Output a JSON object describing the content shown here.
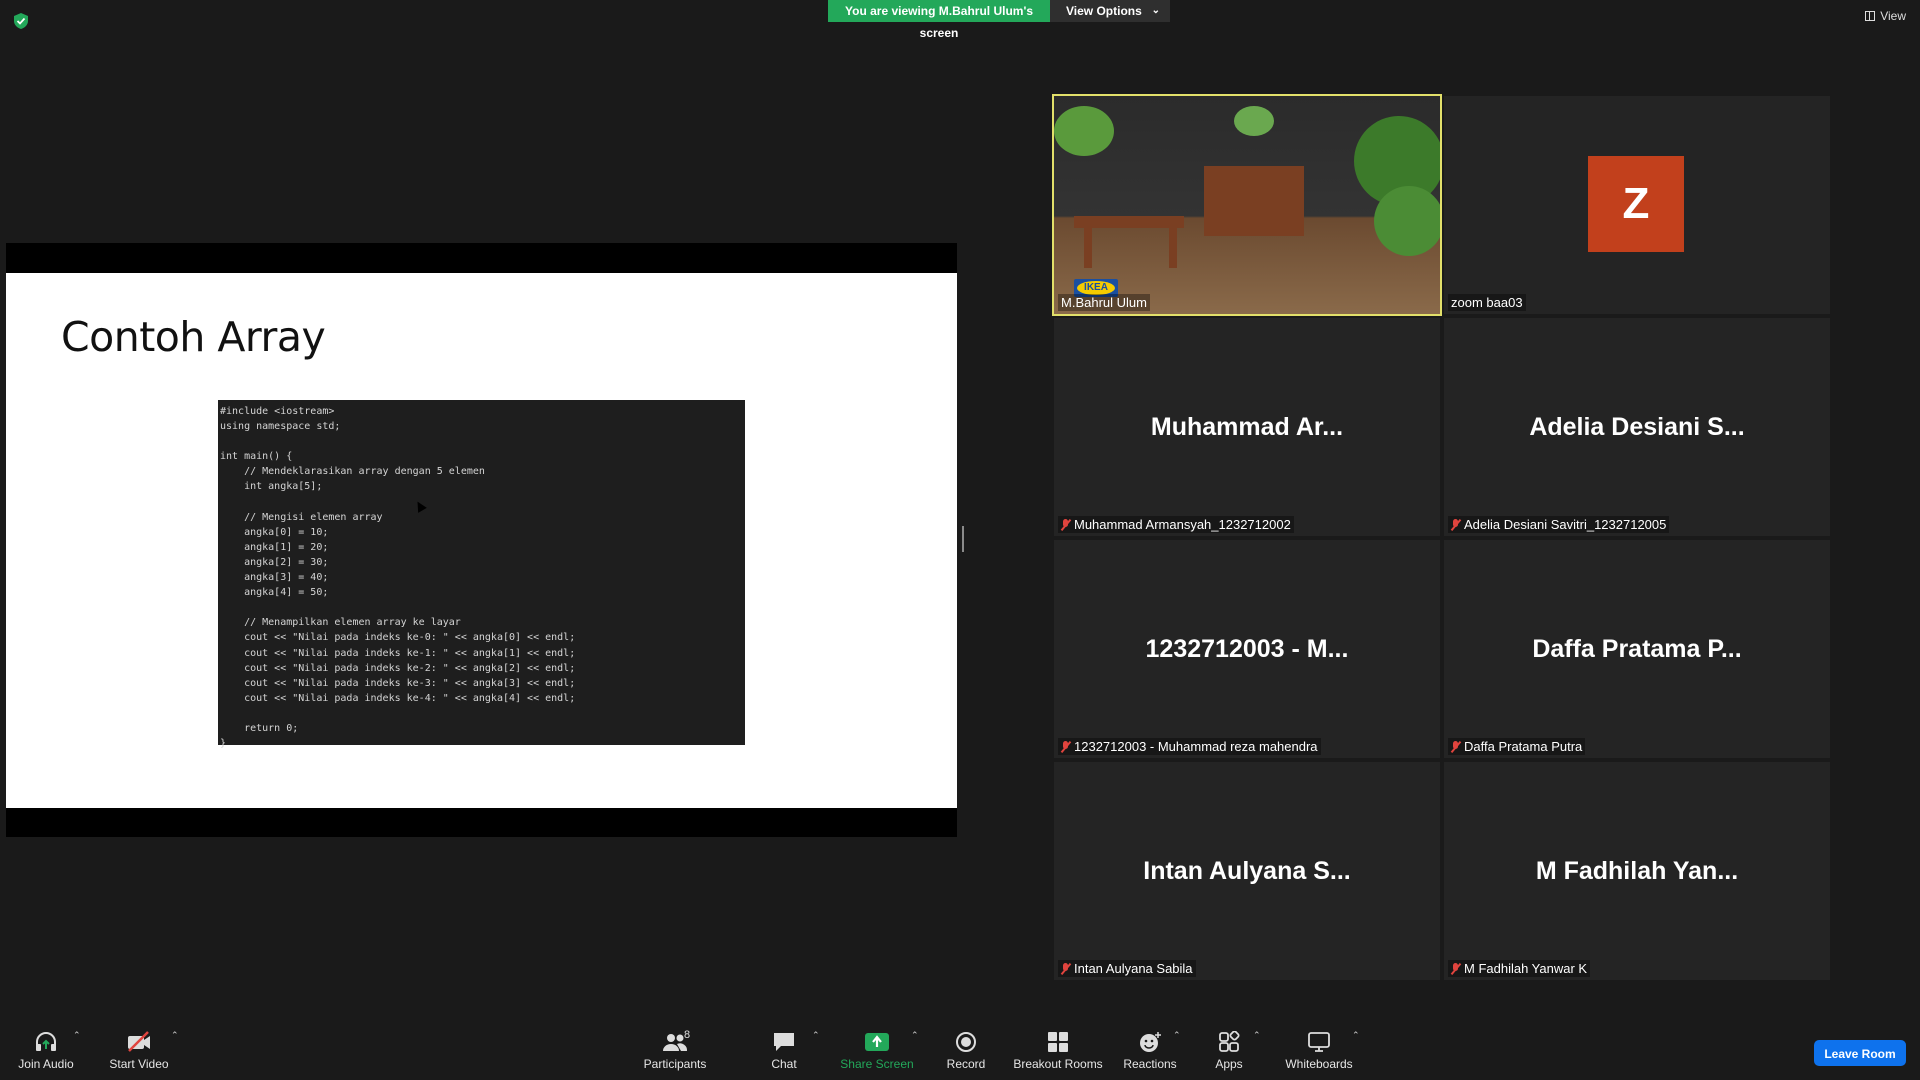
{
  "top": {
    "banner_text": "You are viewing M.Bahrul Ulum's screen",
    "view_options_label": "View Options",
    "view_label": "View",
    "banner_color": "#23a85a"
  },
  "shared_screen": {
    "slide_title": "Contoh Array",
    "code": "#include <iostream>\nusing namespace std;\n\nint main() {\n    // Mendeklarasikan array dengan 5 elemen\n    int angka[5];\n\n    // Mengisi elemen array\n    angka[0] = 10;\n    angka[1] = 20;\n    angka[2] = 30;\n    angka[3] = 40;\n    angka[4] = 50;\n\n    // Menampilkan elemen array ke layar\n    cout << \"Nilai pada indeks ke-0: \" << angka[0] << endl;\n    cout << \"Nilai pada indeks ke-1: \" << angka[1] << endl;\n    cout << \"Nilai pada indeks ke-2: \" << angka[2] << endl;\n    cout << \"Nilai pada indeks ke-3: \" << angka[3] << endl;\n    cout << \"Nilai pada indeks ke-4: \" << angka[4] << endl;\n\n    return 0;\n}"
  },
  "participants_gallery": [
    {
      "display": "",
      "label": "M.Bahrul Ulum",
      "type": "video",
      "active": true,
      "muted": false
    },
    {
      "display": "Z",
      "label": "zoom baa03",
      "type": "avatar",
      "muted": false,
      "avatar_color": "#c2401c"
    },
    {
      "display": "Muhammad Ar...",
      "label": "Muhammad Armansyah_1232712002",
      "type": "name",
      "muted": true
    },
    {
      "display": "Adelia Desiani S...",
      "label": "Adelia Desiani Savitri_1232712005",
      "type": "name",
      "muted": true
    },
    {
      "display": "1232712003 - M...",
      "label": "1232712003 - Muhammad reza mahendra",
      "type": "name",
      "muted": true
    },
    {
      "display": "Daffa Pratama P...",
      "label": "Daffa Pratama Putra",
      "type": "name",
      "muted": true
    },
    {
      "display": "Intan Aulyana S...",
      "label": "Intan Aulyana Sabila",
      "type": "name",
      "muted": true
    },
    {
      "display": "M Fadhilah Yan...",
      "label": "M Fadhilah Yanwar K",
      "type": "name",
      "muted": true
    }
  ],
  "toolbar": {
    "join_audio": "Join Audio",
    "start_video": "Start Video",
    "participants": "Participants",
    "participants_count": "8",
    "chat": "Chat",
    "share_screen": "Share Screen",
    "record": "Record",
    "breakout_rooms": "Breakout Rooms",
    "reactions": "Reactions",
    "apps": "Apps",
    "whiteboards": "Whiteboards",
    "leave_room": "Leave Room",
    "share_color": "#23a85a",
    "leave_color": "#0e72ed"
  }
}
